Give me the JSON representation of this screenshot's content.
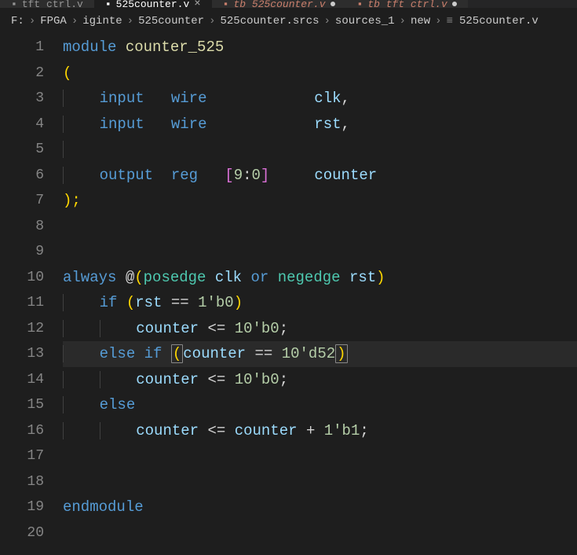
{
  "tabs": [
    {
      "label": "tft_ctrl.v",
      "active": false,
      "modified": true,
      "italic": false,
      "warn": false
    },
    {
      "label": "525counter.v",
      "active": true,
      "modified": false,
      "italic": false,
      "warn": false
    },
    {
      "label": "tb_525counter.v",
      "active": false,
      "modified": true,
      "italic": true,
      "warn": true
    },
    {
      "label": "tb_tft_ctrl.v",
      "active": false,
      "modified": true,
      "italic": true,
      "warn": true
    }
  ],
  "breadcrumb": [
    "F:",
    "FPGA",
    "iginte",
    "525counter",
    "525counter.srcs",
    "sources_1",
    "new",
    "525counter.v"
  ],
  "breadcrumb_last_icon": "≡",
  "line_numbers": [
    "1",
    "2",
    "3",
    "4",
    "5",
    "6",
    "7",
    "8",
    "9",
    "10",
    "11",
    "12",
    "13",
    "14",
    "15",
    "16",
    "17",
    "18",
    "19",
    "20"
  ],
  "code": {
    "module_kw": "module",
    "module_name": "counter_525",
    "open_paren": "(",
    "input_kw": "input",
    "wire_kw": "wire",
    "clk": "clk",
    "rst": "rst",
    "output_kw": "output",
    "reg_kw": "reg",
    "range_open": "[",
    "range_hi": "9",
    "range_colon": ":",
    "range_lo": "0",
    "range_close": "]",
    "counter_id": "counter",
    "close_paren_semi": ");",
    "always_kw": "always",
    "at": "@",
    "posedge": "posedge",
    "or_kw": "or",
    "negedge": "negedge",
    "if_kw": "if",
    "eq": "==",
    "b0_1": "1'b0",
    "le": "<=",
    "ten_b0": "10'b0",
    "else_kw": "else",
    "ten_d52": "10'd52",
    "plus": "+",
    "b1_1": "1'b1",
    "endmodule": "endmodule",
    "comma": ",",
    "semi": ";",
    "paren_open": "(",
    "paren_close": ")"
  },
  "highlighted_line_index": 12
}
